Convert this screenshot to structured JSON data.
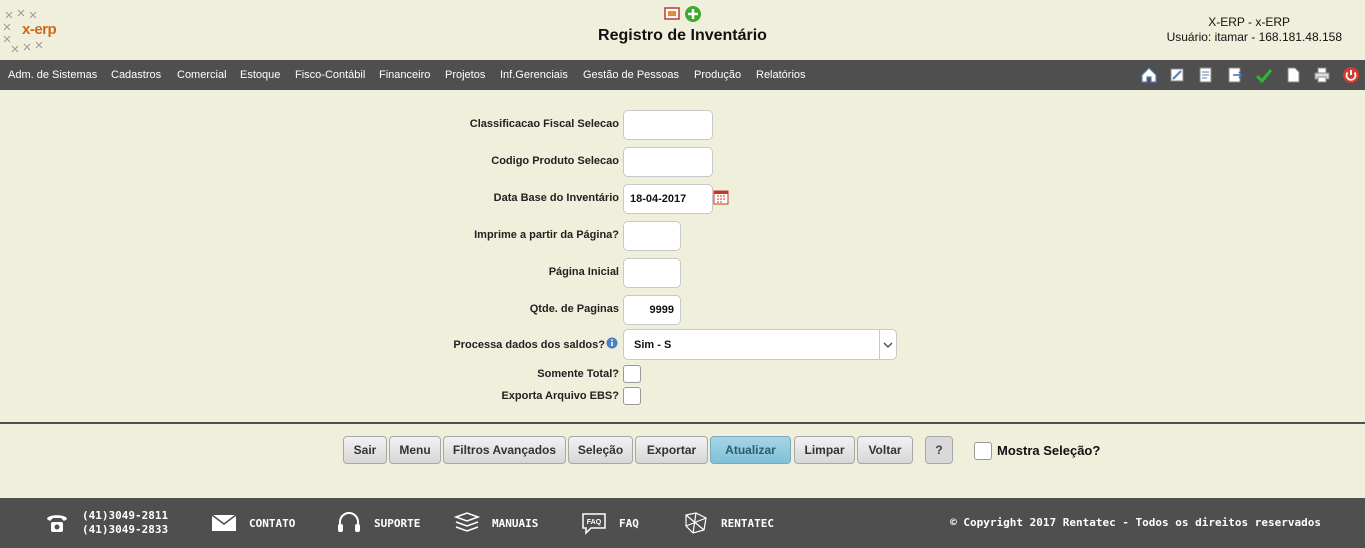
{
  "header": {
    "logo_text": "x-erp",
    "title": "Registro de Inventário",
    "app_name": "X-ERP - x-ERP",
    "user_info": "Usuário: itamar - 168.181.48.158"
  },
  "menu": [
    "Adm. de Sistemas",
    "Cadastros",
    "Comercial",
    "Estoque",
    "Fisco-Contábil",
    "Financeiro",
    "Projetos",
    "Inf.Gerenciais",
    "Gestão de Pessoas",
    "Produção",
    "Relatórios"
  ],
  "toolbar_icons": [
    "home-icon",
    "edit-icon",
    "document-edit-icon",
    "export-icon",
    "check-icon",
    "new-document-icon",
    "print-icon",
    "power-icon"
  ],
  "form": {
    "classificacao_label": "Classificacao Fiscal Selecao",
    "classificacao_value": "",
    "codigo_label": "Codigo Produto Selecao",
    "codigo_value": "",
    "data_base_label": "Data Base do Inventário",
    "data_base_value": "18-04-2017",
    "imprime_label": "Imprime a partir da Página?",
    "imprime_value": "",
    "pagina_inicial_label": "Página Inicial",
    "pagina_inicial_value": "",
    "qtde_label": "Qtde. de Paginas",
    "qtde_value": "9999",
    "processa_label": "Processa dados dos saldos?",
    "processa_value": "Sim - S",
    "somente_total_label": "Somente Total?",
    "exporta_ebs_label": "Exporta Arquivo EBS?"
  },
  "buttons": {
    "sair": "Sair",
    "menu": "Menu",
    "filtros": "Filtros Avançados",
    "selecao": "Seleção",
    "exportar": "Exportar",
    "atualizar": "Atualizar",
    "limpar": "Limpar",
    "voltar": "Voltar",
    "help": "?",
    "mostra_selecao": "Mostra Seleção?"
  },
  "footer": {
    "phone1": "(41)3049-2811",
    "phone2": "(41)3049-2833",
    "contato": "CONTATO",
    "suporte": "SUPORTE",
    "manuais": "MANUAIS",
    "faq": "FAQ",
    "rentatec": "RENTATEC",
    "copyright": "© Copyright 2017 Rentatec - Todos os direitos reservados"
  },
  "colors": {
    "background": "#efefdb",
    "bar": "#4f4f4f",
    "primary_button": "#8fc9dd",
    "logo_orange": "#d06a1a"
  }
}
